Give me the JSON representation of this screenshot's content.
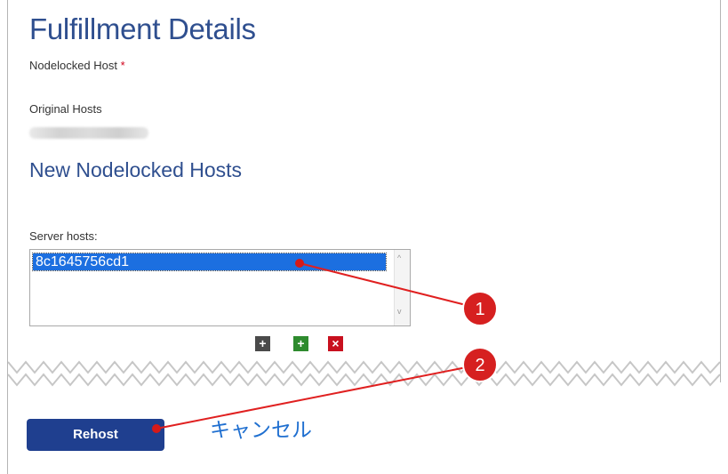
{
  "page": {
    "title": "Fulfillment Details",
    "nodelocked_label": "Nodelocked Host",
    "required_marker": "*",
    "original_hosts_label": "Original Hosts",
    "section_title": "New Nodelocked Hosts",
    "server_hosts_label": "Server hosts:",
    "server_hosts": [
      "8c1645756cd1"
    ],
    "scroll_up_glyph": "^",
    "scroll_down_glyph": "v",
    "icons": [
      "copy-add-icon",
      "add-icon",
      "delete-icon"
    ],
    "rehost_label": "Rehost",
    "cancel_label": "キャンセル"
  },
  "annotations": {
    "badge1": "1",
    "badge2": "2",
    "color": "#e02020"
  }
}
